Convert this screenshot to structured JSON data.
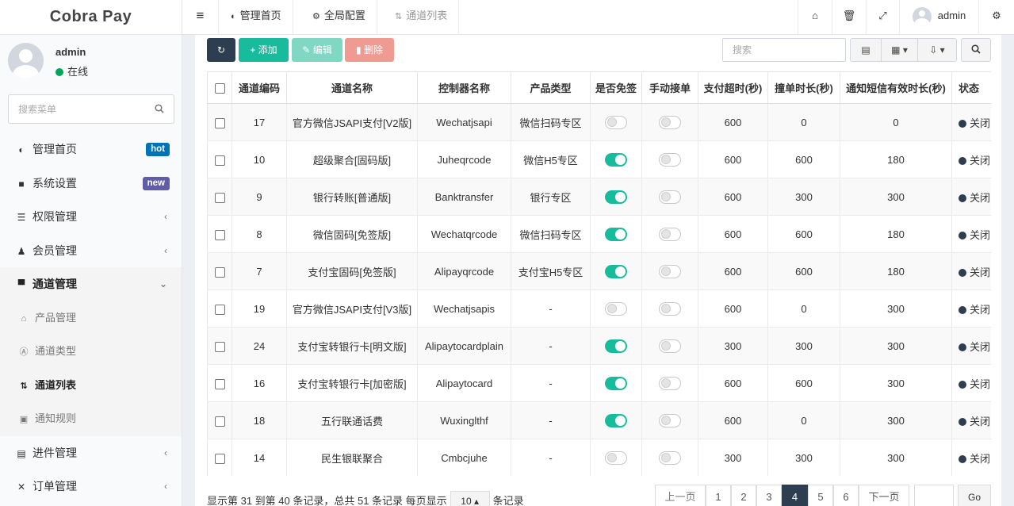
{
  "app": {
    "title": "Cobra Pay"
  },
  "user": {
    "name": "admin",
    "status": "在线"
  },
  "sidebar": {
    "search_placeholder": "搜索菜单",
    "items": [
      {
        "label": "管理首页",
        "icon": "dashboard-icon",
        "badge": "hot",
        "badge_color": "#0073b7"
      },
      {
        "label": "系统设置",
        "icon": "folder-icon",
        "badge": "new",
        "badge_color": "#605ca8"
      },
      {
        "label": "权限管理",
        "icon": "list-icon"
      },
      {
        "label": "会员管理",
        "icon": "user-plus-icon"
      },
      {
        "label": "通道管理",
        "icon": "cart-icon"
      }
    ],
    "sub_items": [
      {
        "label": "产品管理",
        "icon": "bank-icon"
      },
      {
        "label": "通道类型",
        "icon": "font-icon"
      },
      {
        "label": "通道列表",
        "icon": "exchange-icon"
      },
      {
        "label": "通知规则",
        "icon": "calendar-icon"
      }
    ],
    "items_after": [
      {
        "label": "进件管理",
        "icon": "id-card-icon"
      },
      {
        "label": "订单管理",
        "icon": "share-icon"
      }
    ]
  },
  "topbar": {
    "tabs": [
      {
        "label": "管理首页",
        "icon": "dashboard-icon"
      },
      {
        "label": "全局配置",
        "icon": "cogs-icon"
      },
      {
        "label": "通道列表",
        "icon": "exchange-icon"
      }
    ],
    "username": "admin"
  },
  "toolbar": {
    "add_label": "添加",
    "edit_label": "编辑",
    "delete_label": "删除",
    "search_placeholder": "搜索"
  },
  "table": {
    "columns": [
      "通道编码",
      "通道名称",
      "控制器名称",
      "产品类型",
      "是否免签",
      "手动接单",
      "支付超时(秒)",
      "撞单时长(秒)",
      "通知短信有效时长(秒)",
      "状态"
    ],
    "rows": [
      {
        "code": "17",
        "name": "官方微信JSAPI支付[V2版]",
        "controller": "Wechatjsapi",
        "product": "微信扫码专区",
        "free_sign": false,
        "manual": false,
        "pay_timeout": "600",
        "collision": "0",
        "sms_valid": "0",
        "status": "关闭"
      },
      {
        "code": "10",
        "name": "超级聚合[固码版]",
        "controller": "Juheqrcode",
        "product": "微信H5专区",
        "free_sign": true,
        "manual": false,
        "pay_timeout": "600",
        "collision": "600",
        "sms_valid": "180",
        "status": "关闭"
      },
      {
        "code": "9",
        "name": "银行转账[普通版]",
        "controller": "Banktransfer",
        "product": "银行专区",
        "free_sign": true,
        "manual": false,
        "pay_timeout": "600",
        "collision": "300",
        "sms_valid": "300",
        "status": "关闭"
      },
      {
        "code": "8",
        "name": "微信固码[免签版]",
        "controller": "Wechatqrcode",
        "product": "微信扫码专区",
        "free_sign": true,
        "manual": false,
        "pay_timeout": "600",
        "collision": "600",
        "sms_valid": "180",
        "status": "关闭"
      },
      {
        "code": "7",
        "name": "支付宝固码[免签版]",
        "controller": "Alipayqrcode",
        "product": "支付宝H5专区",
        "free_sign": true,
        "manual": false,
        "pay_timeout": "600",
        "collision": "600",
        "sms_valid": "180",
        "status": "关闭"
      },
      {
        "code": "19",
        "name": "官方微信JSAPI支付[V3版]",
        "controller": "Wechatjsapis",
        "product": "-",
        "free_sign": false,
        "manual": false,
        "pay_timeout": "600",
        "collision": "0",
        "sms_valid": "300",
        "status": "关闭"
      },
      {
        "code": "24",
        "name": "支付宝转银行卡[明文版]",
        "controller": "Alipaytocardplain",
        "product": "-",
        "free_sign": true,
        "manual": false,
        "pay_timeout": "300",
        "collision": "300",
        "sms_valid": "300",
        "status": "关闭"
      },
      {
        "code": "16",
        "name": "支付宝转银行卡[加密版]",
        "controller": "Alipaytocard",
        "product": "-",
        "free_sign": true,
        "manual": false,
        "pay_timeout": "600",
        "collision": "600",
        "sms_valid": "300",
        "status": "关闭"
      },
      {
        "code": "18",
        "name": "五行联通话费",
        "controller": "Wuxinglthf",
        "product": "-",
        "free_sign": true,
        "manual": false,
        "pay_timeout": "600",
        "collision": "0",
        "sms_valid": "300",
        "status": "关闭"
      },
      {
        "code": "14",
        "name": "民生银联聚合",
        "controller": "Cmbcjuhe",
        "product": "-",
        "free_sign": false,
        "manual": false,
        "pay_timeout": "300",
        "collision": "300",
        "sms_valid": "300",
        "status": "关闭"
      }
    ]
  },
  "pagination": {
    "info_prefix": "显示第 31 到第 40 条记录，总共 51 条记录 每页显示",
    "page_size": "10",
    "info_suffix": "条记录",
    "prev": "上一页",
    "next": "下一页",
    "pages": [
      "1",
      "2",
      "3",
      "4",
      "5",
      "6"
    ],
    "current": "4",
    "go": "Go"
  },
  "colors": {
    "accent": "#18bc9c",
    "dark": "#2c3e50",
    "online": "#00a65a",
    "danger": "#e74c3c"
  }
}
